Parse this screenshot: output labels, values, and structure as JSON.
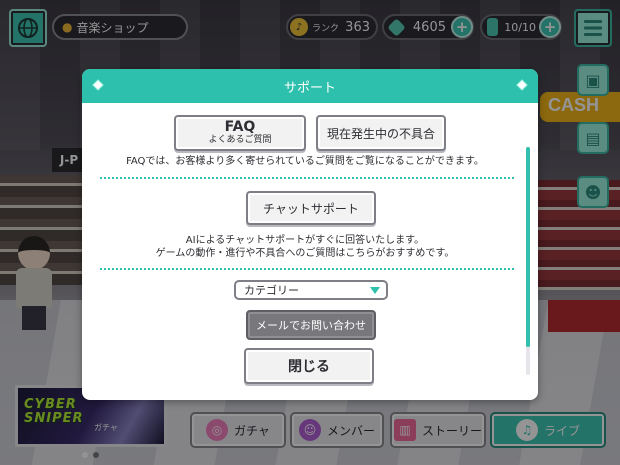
{
  "header": {
    "location": "音楽ショップ",
    "rank_label": "ランク",
    "rank_value": "363",
    "gems": "4605",
    "tickets": "10/10"
  },
  "banner": {
    "title_line1": "CYBER",
    "title_line2": "SNIPER",
    "subtitle": "ガチャ"
  },
  "nav": {
    "gacha": "ガチャ",
    "member": "メンバー",
    "story": "ストーリー",
    "live": "ライブ"
  },
  "dialog": {
    "title": "サポート",
    "faq_label": "FAQ",
    "faq_sub": "よくあるご質問",
    "issues_label": "現在発生中の不具合",
    "faq_desc": "FAQでは、お客様より多く寄せられているご質問をご覧になることができます。",
    "chat_label": "チャットサポート",
    "chat_desc_line1": "AIによるチャットサポートがすぐに回答いたします。",
    "chat_desc_line2": "ゲームの動作・進行や不具合へのご質問はこちらがおすすめです。",
    "category_select": "カテゴリー",
    "mail_label": "メールでお問い合わせ",
    "close_label": "閉じる"
  },
  "colors": {
    "accent": "#2dc0ad",
    "dialog_bg": "#ffffff",
    "disabled_button": "#77777c"
  },
  "icons": [
    "globe-icon",
    "location-pin-icon",
    "rank-badge-icon",
    "gem-icon",
    "ticket-icon",
    "plus-icon",
    "menu-icon",
    "gift-icon",
    "clipboard-icon",
    "friends-icon",
    "gacha-icon",
    "member-icon",
    "story-book-icon",
    "music-note-icon",
    "caret-down-icon"
  ]
}
